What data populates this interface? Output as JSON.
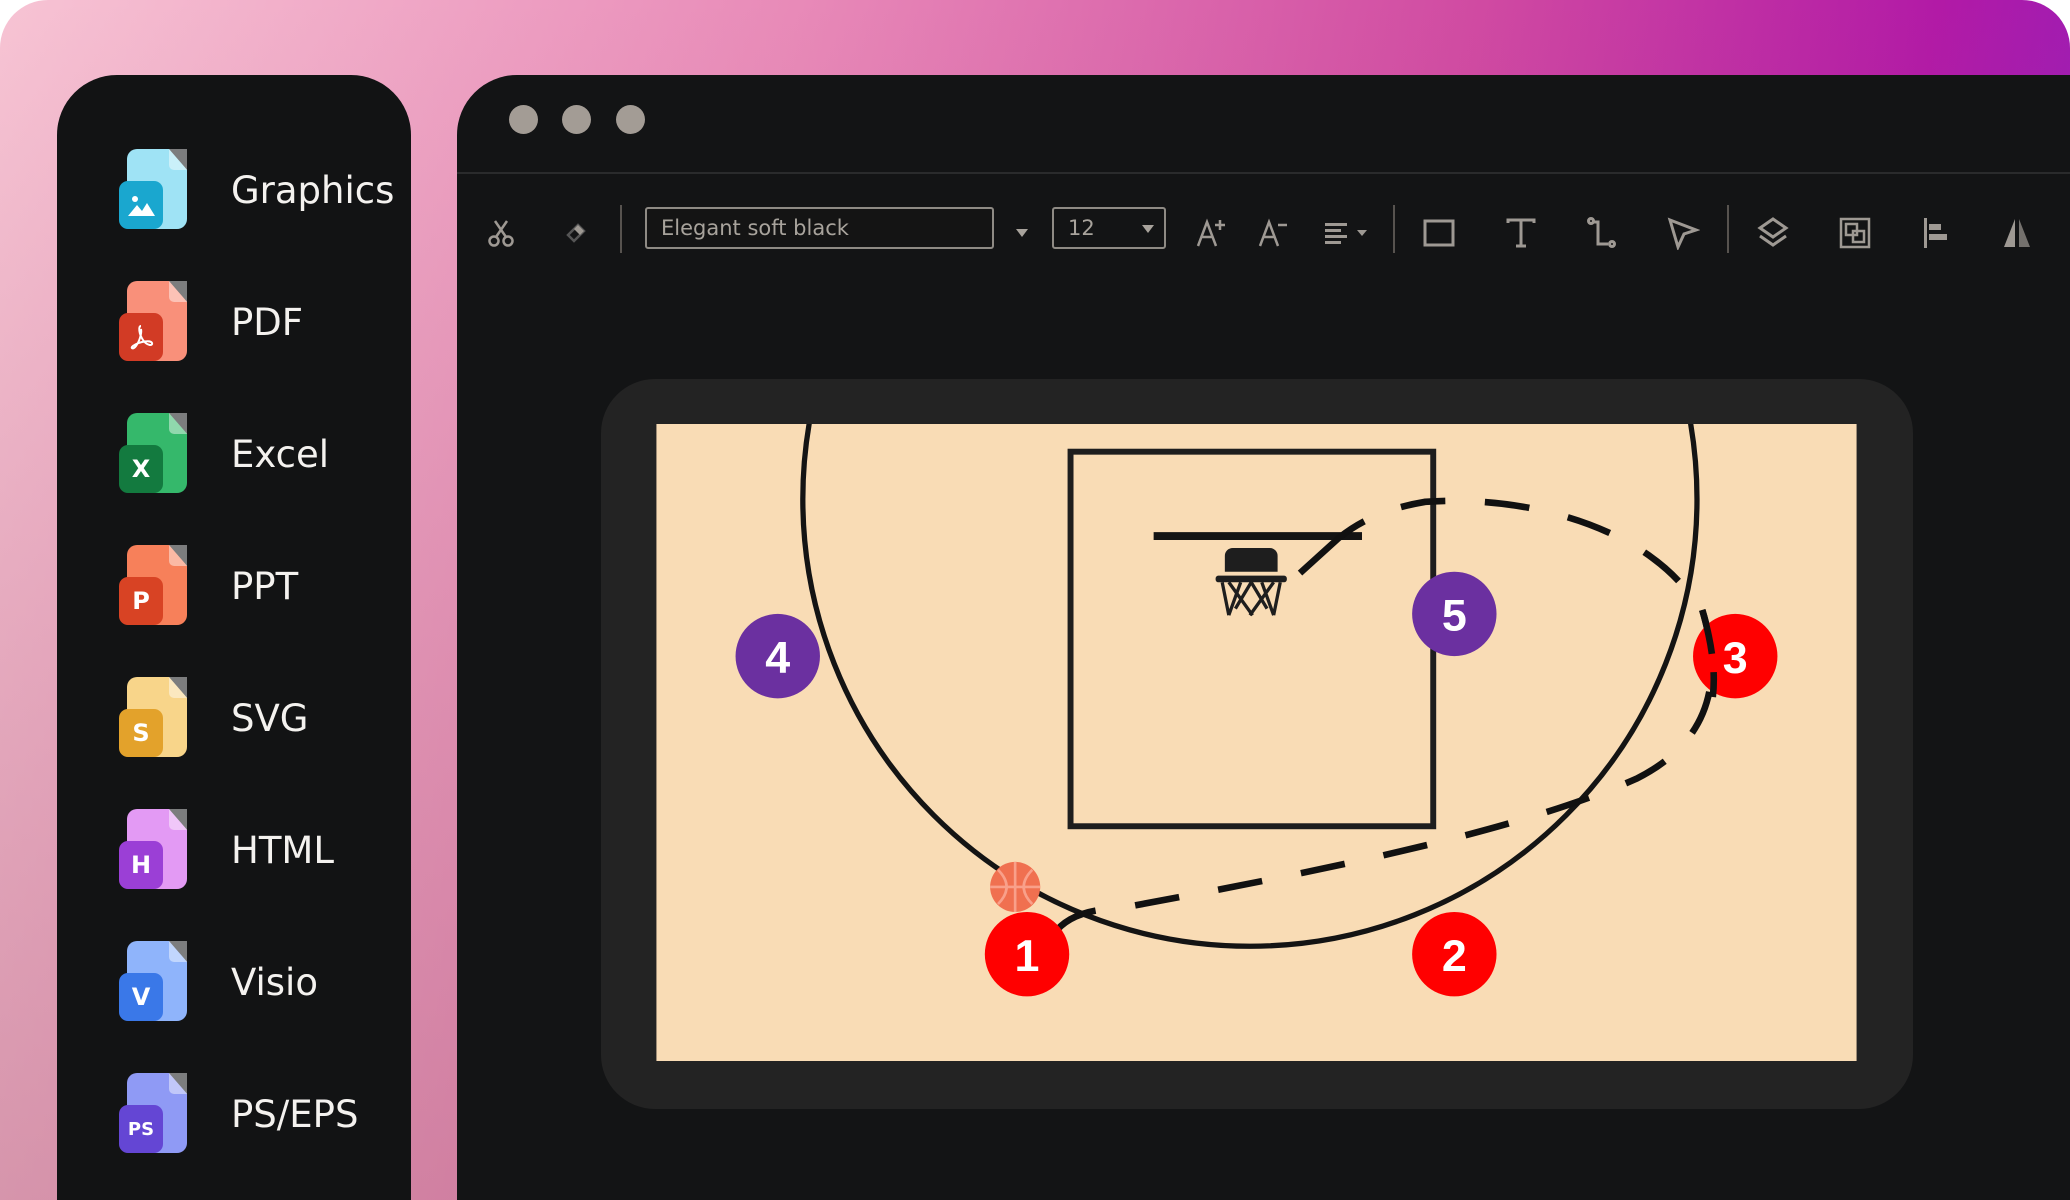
{
  "sidebar": {
    "items": [
      {
        "label": "Graphics",
        "icon": "graphics-file-icon",
        "badge": "",
        "back": "#9fe3f5",
        "front": "#1aa7cf"
      },
      {
        "label": "PDF",
        "icon": "pdf-file-icon",
        "badge": "",
        "back": "#f9907a",
        "front": "#d23b25"
      },
      {
        "label": "Excel",
        "icon": "excel-file-icon",
        "badge": "X",
        "back": "#35b86b",
        "front": "#137a3f"
      },
      {
        "label": "PPT",
        "icon": "ppt-file-icon",
        "badge": "P",
        "back": "#f7805a",
        "front": "#d84324"
      },
      {
        "label": "SVG",
        "icon": "svg-file-icon",
        "badge": "S",
        "back": "#f8d58a",
        "front": "#e3a22b"
      },
      {
        "label": "HTML",
        "icon": "html-file-icon",
        "badge": "H",
        "back": "#e39af4",
        "front": "#9b3fd6"
      },
      {
        "label": "Visio",
        "icon": "visio-file-icon",
        "badge": "V",
        "back": "#8fb4fb",
        "front": "#3a78e8"
      },
      {
        "label": "PS/EPS",
        "icon": "ps-eps-file-icon",
        "badge": "PS",
        "back": "#8f9af5",
        "front": "#6446d4"
      }
    ]
  },
  "toolbar": {
    "font_value": "Elegant soft black",
    "font_size": "12",
    "icons": [
      "scissors-icon",
      "format-painter-icon",
      "font-dropdown-arrow-icon",
      "increase-font-icon",
      "decrease-font-icon",
      "align-icon",
      "rectangle-icon",
      "text-icon",
      "connector-icon",
      "pointer-icon",
      "layers-icon",
      "group-icon",
      "align-left-icon",
      "flip-icon"
    ]
  },
  "court": {
    "colors": {
      "floor": "#f9dcb5",
      "line": "#141414",
      "offense": "#ff0000",
      "defense": "#6b30a0",
      "ball": "#f07050"
    },
    "players": [
      {
        "label": "1",
        "team": "offense"
      },
      {
        "label": "2",
        "team": "offense"
      },
      {
        "label": "3",
        "team": "offense"
      },
      {
        "label": "4",
        "team": "defense"
      },
      {
        "label": "5",
        "team": "defense"
      }
    ]
  }
}
